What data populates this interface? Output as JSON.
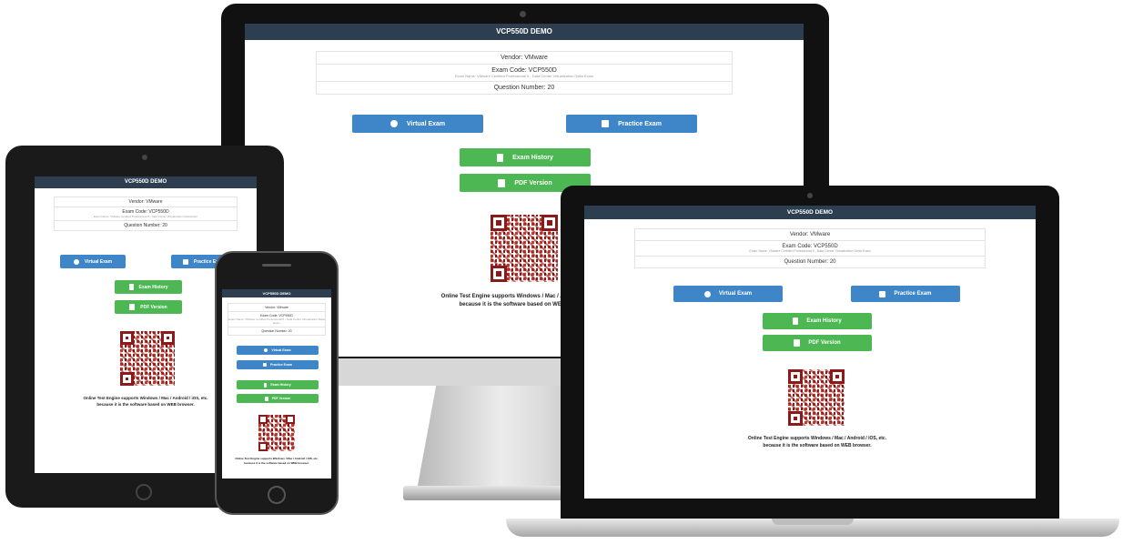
{
  "app": {
    "title": "VCP550D DEMO",
    "vendor": "Vendor: VMware",
    "exam_code": "Exam Code: VCP550D",
    "exam_name": "Exam Name: VMware Certified Professional 5 - Data Center Virtualization Delta Exam",
    "question_number": "Question Number: 20",
    "virtual_exam": "Virtual Exam",
    "practice_exam": "Practice Exam",
    "exam_history": "Exam History",
    "pdf_version": "PDF Version",
    "note_line1": "Online Test Engine supports Windows / Mac / Android / iOS, etc.",
    "note_line2": "because it is the software based on WEB browser."
  },
  "colors": {
    "header": "#2c3e50",
    "blue_button": "#3f86c8",
    "green_button": "#4cb753",
    "qr": "#c0392b"
  }
}
